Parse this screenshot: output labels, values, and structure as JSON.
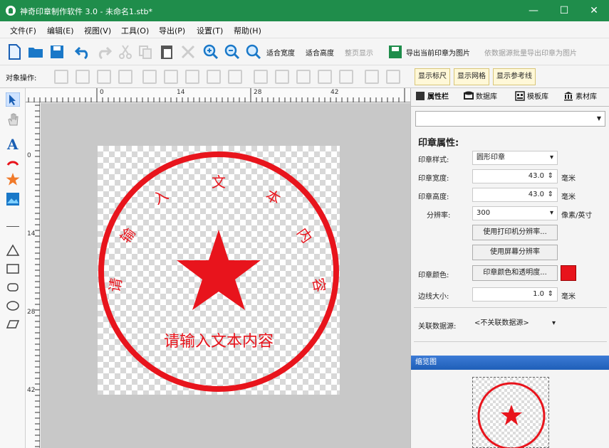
{
  "window": {
    "title": "神奇印章制作软件 3.0 - 未命名1.stb*",
    "minimize": "—",
    "maximize": "☐",
    "close": "✕"
  },
  "menu": [
    "文件(F)",
    "编辑(E)",
    "视图(V)",
    "工具(O)",
    "导出(P)",
    "设置(T)",
    "帮助(H)"
  ],
  "toolbar": {
    "fit_width": "适合宽度",
    "fit_height": "适合高度",
    "full_page": "整页显示",
    "export_image": "导出当前印章为图片",
    "batch_export": "依数据源批量导出印章为图片"
  },
  "toolbar2": {
    "label": "对象操作:",
    "show_ruler": "显示标尺",
    "show_grid": "显示网格",
    "show_guides": "显示参考线"
  },
  "rulers": {
    "h_labels": [
      "0",
      "14",
      "28",
      "42"
    ],
    "v_labels": [
      "0",
      "14",
      "28",
      "42"
    ]
  },
  "stamp": {
    "top_text": [
      "请",
      "输",
      "入",
      "文",
      "本",
      "内",
      "容"
    ],
    "bottom_text": "请输入文本内容",
    "color": "#e8141c"
  },
  "right_panel": {
    "tabs": [
      "属性栏",
      "数据库",
      "模板库",
      "素材库"
    ],
    "section_title": "印章属性:",
    "style_label": "印章样式:",
    "style_value": "圆形印章",
    "width_label": "印章宽度:",
    "width_value": "43.0",
    "width_unit": "毫米",
    "height_label": "印章高度:",
    "height_value": "43.0",
    "height_unit": "毫米",
    "resolution_label": "分辨率:",
    "resolution_value": "300",
    "resolution_unit": "像素/英寸",
    "btn_printer_res": "使用打印机分辨率...",
    "btn_screen_res": "使用屏幕分辨率",
    "color_label": "印章颜色:",
    "btn_color": "印章颜色和透明度...",
    "color_value": "#e8141c",
    "border_label": "边线大小:",
    "border_value": "1.0",
    "border_unit": "毫米",
    "datasource_label": "关联数据源:",
    "datasource_value": "<不关联数据源>",
    "preview_title": "缩览图"
  }
}
